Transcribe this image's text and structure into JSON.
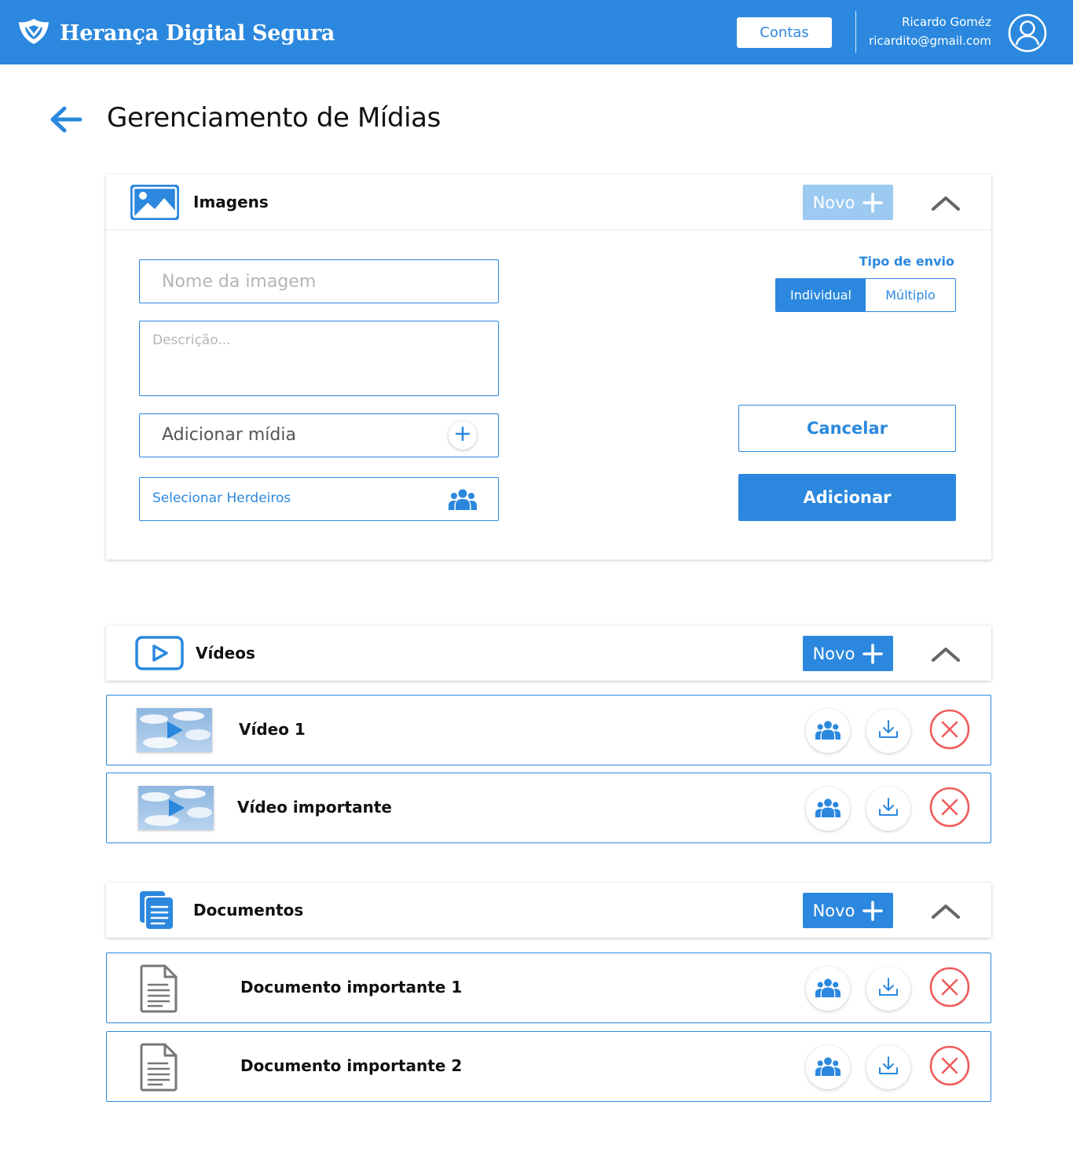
{
  "header": {
    "brand": "Herança Digital Segura",
    "accounts_button": "Contas",
    "user_name": "Ricardo Goméz",
    "user_email": "ricardito@gmail.com"
  },
  "page": {
    "title": "Gerenciamento de Mídias"
  },
  "images_section": {
    "title": "Imagens",
    "new_button": "Novo",
    "name_placeholder": "Nome da imagem",
    "description_placeholder": "Descrição...",
    "add_media_label": "Adicionar mídia",
    "select_heirs_label": "Selecionar Herdeiros",
    "send_type_label": "Tipo de envio",
    "send_type_options": [
      "Individual",
      "Múltiplo"
    ],
    "send_type_selected": "Individual",
    "cancel_button": "Cancelar",
    "add_button": "Adicionar"
  },
  "videos_section": {
    "title": "Vídeos",
    "new_button": "Novo",
    "items": [
      {
        "name": "Vídeo 1"
      },
      {
        "name": "Vídeo importante"
      }
    ]
  },
  "documents_section": {
    "title": "Documentos",
    "new_button": "Novo",
    "items": [
      {
        "name": "Documento importante 1"
      },
      {
        "name": "Documento importante 2"
      }
    ]
  },
  "colors": {
    "primary": "#2b88de",
    "primary_light": "#9ccaf0",
    "danger": "#ef5b5b",
    "icon_gray": "#777777"
  },
  "icons": {
    "brand": "shield-icon",
    "avatar": "user-avatar-icon",
    "back": "arrow-left-icon",
    "images": "image-icon",
    "videos": "play-video-icon",
    "documents": "documents-icon",
    "add": "plus-icon",
    "collapse": "chevron-up-icon",
    "heirs": "group-icon",
    "download": "download-icon",
    "remove": "close-circle-icon",
    "document_item": "document-file-icon"
  }
}
